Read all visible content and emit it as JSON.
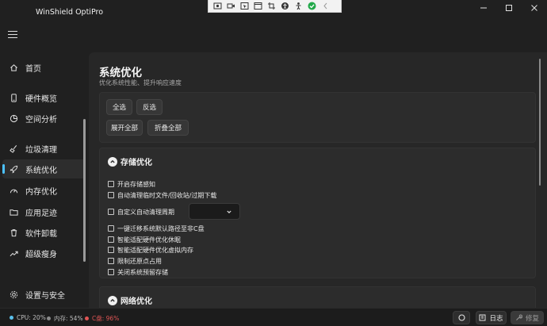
{
  "app": {
    "title": "WinShield OptiPro"
  },
  "capture_toolbar": {
    "icons": [
      "screenshot-icon",
      "video-icon",
      "window-capture-icon",
      "window-icon",
      "crop-icon",
      "accessibility-icon",
      "person-icon",
      "check-icon",
      "chevron-left-icon"
    ],
    "accent": "#22a94a"
  },
  "sidebar": {
    "items": [
      {
        "label": "首页",
        "icon": "home-icon",
        "active": false
      },
      {
        "label": "硬件概览",
        "icon": "device-icon",
        "active": false
      },
      {
        "label": "空间分析",
        "icon": "pie-chart-icon",
        "active": false
      },
      {
        "label": "垃圾清理",
        "icon": "broom-icon",
        "active": false
      },
      {
        "label": "系统优化",
        "icon": "rocket-icon",
        "active": true
      },
      {
        "label": "内存优化",
        "icon": "gauge-icon",
        "active": false
      },
      {
        "label": "应用足迹",
        "icon": "folder-icon",
        "active": false
      },
      {
        "label": "软件卸载",
        "icon": "trash-icon",
        "active": false
      },
      {
        "label": "超级瘦身",
        "icon": "trend-icon",
        "active": false
      }
    ],
    "settings": {
      "label": "设置与安全",
      "icon": "shield-gear-icon"
    }
  },
  "page": {
    "title": "系统优化",
    "subtitle": "优化系统性能、提升响应速度",
    "actions": {
      "select_all": "全选",
      "invert": "反选",
      "expand_all": "展开全部",
      "collapse_all": "折叠全部"
    }
  },
  "sections": {
    "storage": {
      "title": "存储优化",
      "options": [
        {
          "label": "开启存储感知",
          "checked": false
        },
        {
          "label": "自动清理临时文件/回收站/过期下载",
          "checked": false
        },
        {
          "label": "自定义自动清理周期",
          "checked": false,
          "select_value": ""
        },
        {
          "label": "一键迁移系统默认路径至非C盘",
          "checked": false
        },
        {
          "label": "智能适配硬件优化休眠",
          "checked": false
        },
        {
          "label": "智能适配硬件优化虚拟内存",
          "checked": false
        },
        {
          "label": "限制还原点占用",
          "checked": false
        },
        {
          "label": "关闭系统预留存储",
          "checked": false
        }
      ]
    },
    "network": {
      "title": "网络优化"
    }
  },
  "statusbar": {
    "cpu": "CPU: 20%",
    "memory": "内存: 54%",
    "disk": "C盘: 96%",
    "log_label": "日志",
    "repair_label": "修复",
    "colors": {
      "cpu": "#5bc0eb",
      "memory": "#8a8a8a",
      "disk": "#e05555"
    }
  }
}
